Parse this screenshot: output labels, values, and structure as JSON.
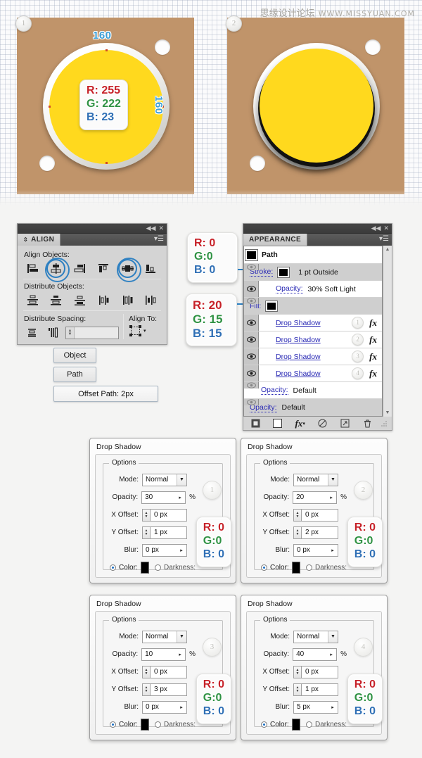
{
  "watermark": {
    "cn": "思缘设计论坛",
    "url": "WWW.MISSYUAN.COM"
  },
  "illustrations": {
    "step1": {
      "badge": "1",
      "dim_top": "160",
      "dim_right": "160",
      "color_chip": {
        "r": "R: 255",
        "g": "G: 222",
        "b": "B: 23"
      },
      "background_color": "#c0946a",
      "button_color": "#ffd91e"
    },
    "step2": {
      "badge": "2",
      "background_color": "#c0946a",
      "button_color": "#ffd91e"
    }
  },
  "align_panel": {
    "title": "ALIGN",
    "align_objects_label": "Align Objects:",
    "distribute_objects_label": "Distribute Objects:",
    "distribute_spacing_label": "Distribute Spacing:",
    "align_to_label": "Align To:",
    "spacing_value": "",
    "align_buttons": [
      {
        "name": "horizontal-align-left",
        "highlighted": false
      },
      {
        "name": "horizontal-align-center",
        "highlighted": true
      },
      {
        "name": "horizontal-align-right",
        "highlighted": false
      },
      {
        "name": "vertical-align-top",
        "highlighted": false
      },
      {
        "name": "vertical-align-center",
        "highlighted": true
      },
      {
        "name": "vertical-align-bottom",
        "highlighted": false
      }
    ],
    "distribute_buttons": [
      "vertical-distribute-top",
      "vertical-distribute-center",
      "vertical-distribute-bottom",
      "horizontal-distribute-left",
      "horizontal-distribute-center",
      "horizontal-distribute-right"
    ],
    "spacing_buttons": [
      "vertical-distribute-space",
      "horizontal-distribute-space"
    ]
  },
  "appearance_panel": {
    "title": "APPEARANCE",
    "rows": [
      {
        "kind": "header",
        "label": "Path",
        "swatch": "#000000"
      },
      {
        "kind": "stroke",
        "label": "Stroke:",
        "swatch": "#000000",
        "value": "1 pt  Outside",
        "shaded": true
      },
      {
        "kind": "opacity",
        "label": "Opacity:",
        "value": "30% Soft Light",
        "shaded": false
      },
      {
        "kind": "fill",
        "label": "Fill:",
        "swatch": "#000000",
        "value": "",
        "shaded": true
      },
      {
        "kind": "effect",
        "label": "Drop Shadow",
        "bubble": "1",
        "fx": "fx",
        "shaded": false
      },
      {
        "kind": "effect",
        "label": "Drop Shadow",
        "bubble": "2",
        "fx": "fx",
        "shaded": false
      },
      {
        "kind": "effect",
        "label": "Drop Shadow",
        "bubble": "3",
        "fx": "fx",
        "shaded": false
      },
      {
        "kind": "effect",
        "label": "Drop Shadow",
        "bubble": "4",
        "fx": "fx",
        "shaded": false
      },
      {
        "kind": "opacity",
        "label": "Opacity:",
        "value": "Default",
        "shaded": false
      },
      {
        "kind": "opacity",
        "label": "Opacity:",
        "value": "Default",
        "shaded": true
      }
    ],
    "footer_buttons": [
      "add-new-stroke-icon",
      "add-new-fill-icon",
      "add-new-effect-icon",
      "clear-appearance-icon",
      "duplicate-item-icon",
      "delete-item-icon"
    ],
    "callout_chips": [
      {
        "r": "R: 0",
        "g": "G:0",
        "b": "B: 0",
        "target": "Stroke:"
      },
      {
        "r": "R: 20",
        "g": "G: 15",
        "b": "B: 15",
        "target": "Fill:"
      }
    ]
  },
  "menu_path": {
    "object": "Object",
    "path": "Path",
    "offset": "Offset Path: 2px"
  },
  "drop_shadow_dialogs": [
    {
      "badge": "1",
      "title": "Drop Shadow",
      "options_legend": "Options",
      "mode_label": "Mode:",
      "mode": "Normal",
      "opacity_label": "Opacity:",
      "opacity": "30",
      "percent": "%",
      "x_offset_label": "X Offset:",
      "x_offset": "0 px",
      "y_offset_label": "Y Offset:",
      "y_offset": "1 px",
      "blur_label": "Blur:",
      "blur": "0 px",
      "color_label": "Color:",
      "darkness_label": "Darkness:",
      "color_swatch": "#000000",
      "chip": {
        "r": "R: 0",
        "g": "G:0",
        "b": "B: 0"
      }
    },
    {
      "badge": "2",
      "title": "Drop Shadow",
      "options_legend": "Options",
      "mode_label": "Mode:",
      "mode": "Normal",
      "opacity_label": "Opacity:",
      "opacity": "20",
      "percent": "%",
      "x_offset_label": "X Offset:",
      "x_offset": "0 px",
      "y_offset_label": "Y Offset:",
      "y_offset": "2 px",
      "blur_label": "Blur:",
      "blur": "0 px",
      "color_label": "Color:",
      "darkness_label": "Darkness:",
      "color_swatch": "#000000",
      "chip": {
        "r": "R: 0",
        "g": "G:0",
        "b": "B: 0"
      }
    },
    {
      "badge": "3",
      "title": "Drop Shadow",
      "options_legend": "Options",
      "mode_label": "Mode:",
      "mode": "Normal",
      "opacity_label": "Opacity:",
      "opacity": "10",
      "percent": "%",
      "x_offset_label": "X Offset:",
      "x_offset": "0 px",
      "y_offset_label": "Y Offset:",
      "y_offset": "3 px",
      "blur_label": "Blur:",
      "blur": "0 px",
      "color_label": "Color:",
      "darkness_label": "Darkness:",
      "color_swatch": "#000000",
      "chip": {
        "r": "R: 0",
        "g": "G:0",
        "b": "B: 0"
      }
    },
    {
      "badge": "4",
      "title": "Drop Shadow",
      "options_legend": "Options",
      "mode_label": "Mode:",
      "mode": "Normal",
      "opacity_label": "Opacity:",
      "opacity": "40",
      "percent": "%",
      "x_offset_label": "X Offset:",
      "x_offset": "0 px",
      "y_offset_label": "Y Offset:",
      "y_offset": "1 px",
      "blur_label": "Blur:",
      "blur": "5 px",
      "color_label": "Color:",
      "darkness_label": "Darkness:",
      "color_swatch": "#000000",
      "chip": {
        "r": "R: 0",
        "g": "G:0",
        "b": "B: 0"
      }
    }
  ],
  "colors": {
    "accent_blue": "#2a7ec1",
    "artboard_tan": "#c0946a",
    "button_yellow": "#ffd91e",
    "label_blue": "#3d9fd6",
    "red": "#c62128",
    "green": "#2f9243",
    "blue": "#2f6fb5"
  }
}
